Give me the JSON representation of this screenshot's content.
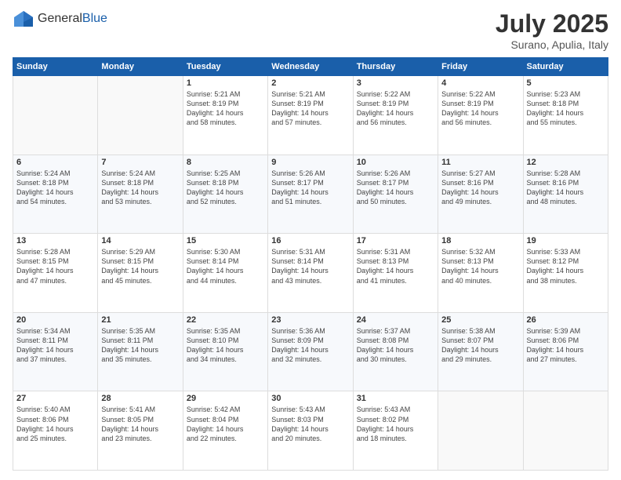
{
  "logo": {
    "general": "General",
    "blue": "Blue"
  },
  "title": "July 2025",
  "subtitle": "Surano, Apulia, Italy",
  "headers": [
    "Sunday",
    "Monday",
    "Tuesday",
    "Wednesday",
    "Thursday",
    "Friday",
    "Saturday"
  ],
  "weeks": [
    [
      {
        "day": "",
        "info": ""
      },
      {
        "day": "",
        "info": ""
      },
      {
        "day": "1",
        "info": "Sunrise: 5:21 AM\nSunset: 8:19 PM\nDaylight: 14 hours\nand 58 minutes."
      },
      {
        "day": "2",
        "info": "Sunrise: 5:21 AM\nSunset: 8:19 PM\nDaylight: 14 hours\nand 57 minutes."
      },
      {
        "day": "3",
        "info": "Sunrise: 5:22 AM\nSunset: 8:19 PM\nDaylight: 14 hours\nand 56 minutes."
      },
      {
        "day": "4",
        "info": "Sunrise: 5:22 AM\nSunset: 8:19 PM\nDaylight: 14 hours\nand 56 minutes."
      },
      {
        "day": "5",
        "info": "Sunrise: 5:23 AM\nSunset: 8:18 PM\nDaylight: 14 hours\nand 55 minutes."
      }
    ],
    [
      {
        "day": "6",
        "info": "Sunrise: 5:24 AM\nSunset: 8:18 PM\nDaylight: 14 hours\nand 54 minutes."
      },
      {
        "day": "7",
        "info": "Sunrise: 5:24 AM\nSunset: 8:18 PM\nDaylight: 14 hours\nand 53 minutes."
      },
      {
        "day": "8",
        "info": "Sunrise: 5:25 AM\nSunset: 8:18 PM\nDaylight: 14 hours\nand 52 minutes."
      },
      {
        "day": "9",
        "info": "Sunrise: 5:26 AM\nSunset: 8:17 PM\nDaylight: 14 hours\nand 51 minutes."
      },
      {
        "day": "10",
        "info": "Sunrise: 5:26 AM\nSunset: 8:17 PM\nDaylight: 14 hours\nand 50 minutes."
      },
      {
        "day": "11",
        "info": "Sunrise: 5:27 AM\nSunset: 8:16 PM\nDaylight: 14 hours\nand 49 minutes."
      },
      {
        "day": "12",
        "info": "Sunrise: 5:28 AM\nSunset: 8:16 PM\nDaylight: 14 hours\nand 48 minutes."
      }
    ],
    [
      {
        "day": "13",
        "info": "Sunrise: 5:28 AM\nSunset: 8:15 PM\nDaylight: 14 hours\nand 47 minutes."
      },
      {
        "day": "14",
        "info": "Sunrise: 5:29 AM\nSunset: 8:15 PM\nDaylight: 14 hours\nand 45 minutes."
      },
      {
        "day": "15",
        "info": "Sunrise: 5:30 AM\nSunset: 8:14 PM\nDaylight: 14 hours\nand 44 minutes."
      },
      {
        "day": "16",
        "info": "Sunrise: 5:31 AM\nSunset: 8:14 PM\nDaylight: 14 hours\nand 43 minutes."
      },
      {
        "day": "17",
        "info": "Sunrise: 5:31 AM\nSunset: 8:13 PM\nDaylight: 14 hours\nand 41 minutes."
      },
      {
        "day": "18",
        "info": "Sunrise: 5:32 AM\nSunset: 8:13 PM\nDaylight: 14 hours\nand 40 minutes."
      },
      {
        "day": "19",
        "info": "Sunrise: 5:33 AM\nSunset: 8:12 PM\nDaylight: 14 hours\nand 38 minutes."
      }
    ],
    [
      {
        "day": "20",
        "info": "Sunrise: 5:34 AM\nSunset: 8:11 PM\nDaylight: 14 hours\nand 37 minutes."
      },
      {
        "day": "21",
        "info": "Sunrise: 5:35 AM\nSunset: 8:11 PM\nDaylight: 14 hours\nand 35 minutes."
      },
      {
        "day": "22",
        "info": "Sunrise: 5:35 AM\nSunset: 8:10 PM\nDaylight: 14 hours\nand 34 minutes."
      },
      {
        "day": "23",
        "info": "Sunrise: 5:36 AM\nSunset: 8:09 PM\nDaylight: 14 hours\nand 32 minutes."
      },
      {
        "day": "24",
        "info": "Sunrise: 5:37 AM\nSunset: 8:08 PM\nDaylight: 14 hours\nand 30 minutes."
      },
      {
        "day": "25",
        "info": "Sunrise: 5:38 AM\nSunset: 8:07 PM\nDaylight: 14 hours\nand 29 minutes."
      },
      {
        "day": "26",
        "info": "Sunrise: 5:39 AM\nSunset: 8:06 PM\nDaylight: 14 hours\nand 27 minutes."
      }
    ],
    [
      {
        "day": "27",
        "info": "Sunrise: 5:40 AM\nSunset: 8:06 PM\nDaylight: 14 hours\nand 25 minutes."
      },
      {
        "day": "28",
        "info": "Sunrise: 5:41 AM\nSunset: 8:05 PM\nDaylight: 14 hours\nand 23 minutes."
      },
      {
        "day": "29",
        "info": "Sunrise: 5:42 AM\nSunset: 8:04 PM\nDaylight: 14 hours\nand 22 minutes."
      },
      {
        "day": "30",
        "info": "Sunrise: 5:43 AM\nSunset: 8:03 PM\nDaylight: 14 hours\nand 20 minutes."
      },
      {
        "day": "31",
        "info": "Sunrise: 5:43 AM\nSunset: 8:02 PM\nDaylight: 14 hours\nand 18 minutes."
      },
      {
        "day": "",
        "info": ""
      },
      {
        "day": "",
        "info": ""
      }
    ]
  ]
}
